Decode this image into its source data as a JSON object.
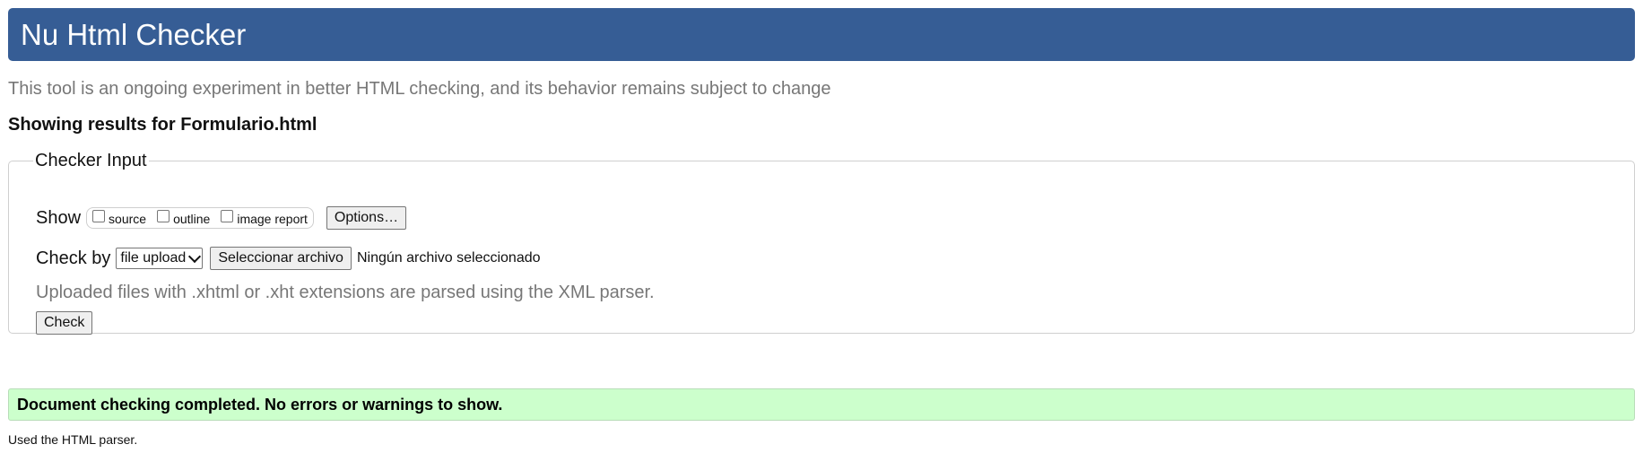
{
  "header": {
    "title": "Nu Html Checker"
  },
  "intro": "This tool is an ongoing experiment in better HTML checking, and its behavior remains subject to change",
  "results_for": "Showing results for Formulario.html",
  "checker_input": {
    "legend": "Checker Input",
    "show": {
      "label": "Show",
      "options": [
        {
          "label": "source",
          "checked": false
        },
        {
          "label": "outline",
          "checked": false
        },
        {
          "label": "image report",
          "checked": false
        }
      ],
      "options_button": "Options…"
    },
    "check_by": {
      "label": "Check by",
      "selected_method": "file upload",
      "file_button": "Seleccionar archivo",
      "file_status": "Ningún archivo seleccionado",
      "note": "Uploaded files with .xhtml or .xht extensions are parsed using the XML parser."
    },
    "check_button": "Check"
  },
  "status": {
    "message": "Document checking completed. No errors or warnings to show."
  },
  "parser_note": "Used the HTML parser.",
  "icons": {
    "dropdown": "chevron-down-icon"
  },
  "colors": {
    "banner": "#365d95",
    "success_background": "#ccffcc",
    "muted_text": "#777777"
  }
}
